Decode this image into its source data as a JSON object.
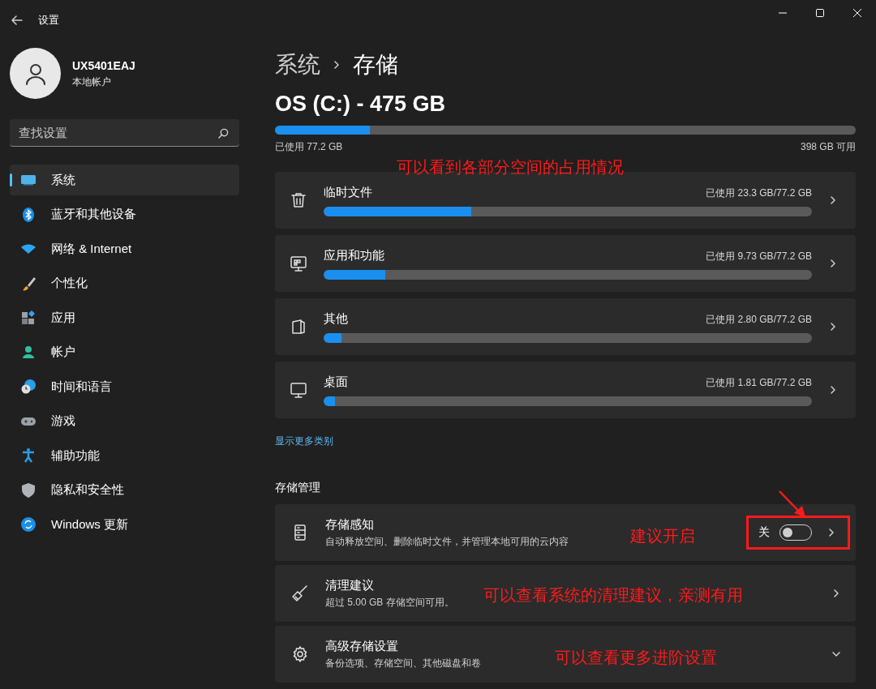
{
  "title_bar": {
    "title": "设置"
  },
  "user": {
    "name": "UX5401EAJ",
    "account_type": "本地帐户"
  },
  "search": {
    "placeholder": "查找设置"
  },
  "nav": [
    {
      "label": "系统",
      "selected": true
    },
    {
      "label": "蓝牙和其他设备",
      "selected": false
    },
    {
      "label": "网络 & Internet",
      "selected": false
    },
    {
      "label": "个性化",
      "selected": false
    },
    {
      "label": "应用",
      "selected": false
    },
    {
      "label": "帐户",
      "selected": false
    },
    {
      "label": "时间和语言",
      "selected": false
    },
    {
      "label": "游戏",
      "selected": false
    },
    {
      "label": "辅助功能",
      "selected": false
    },
    {
      "label": "隐私和安全性",
      "selected": false
    },
    {
      "label": "Windows 更新",
      "selected": false
    }
  ],
  "breadcrumb": {
    "parent": "系统",
    "current": "存储"
  },
  "drive": {
    "title": "OS (C:) - 475 GB",
    "level": 0.163,
    "used": "已使用 77.2 GB",
    "free": "398 GB 可用"
  },
  "categories": [
    {
      "label": "临时文件",
      "usage": "已使用 23.3 GB/77.2 GB",
      "level": 0.302
    },
    {
      "label": "应用和功能",
      "usage": "已使用 9.73 GB/77.2 GB",
      "level": 0.126
    },
    {
      "label": "其他",
      "usage": "已使用 2.80 GB/77.2 GB",
      "level": 0.036
    },
    {
      "label": "桌面",
      "usage": "已使用 1.81 GB/77.2 GB",
      "level": 0.023
    }
  ],
  "show_more_link": "显示更多类别",
  "storage_management": {
    "heading": "存储管理",
    "items": [
      {
        "kind": "toggle",
        "title": "存储感知",
        "description": "自动释放空间、删除临时文件，并管理本地可用的云内容",
        "toggle_label": "关",
        "on": false,
        "highlighted": true
      },
      {
        "kind": "link",
        "title": "清理建议",
        "description": "超过 5.00 GB 存储空间可用。"
      },
      {
        "kind": "expand",
        "title": "高级存储设置",
        "description": "备份选项、存储空间、其他磁盘和卷"
      }
    ]
  },
  "annotations": [
    {
      "text": "可以看到各部分空间的占用情况"
    },
    {
      "text": "建议开启"
    },
    {
      "text": "可以查看系统的清理建议，亲测有用"
    },
    {
      "text": "可以查看更多进阶设置"
    }
  ]
}
